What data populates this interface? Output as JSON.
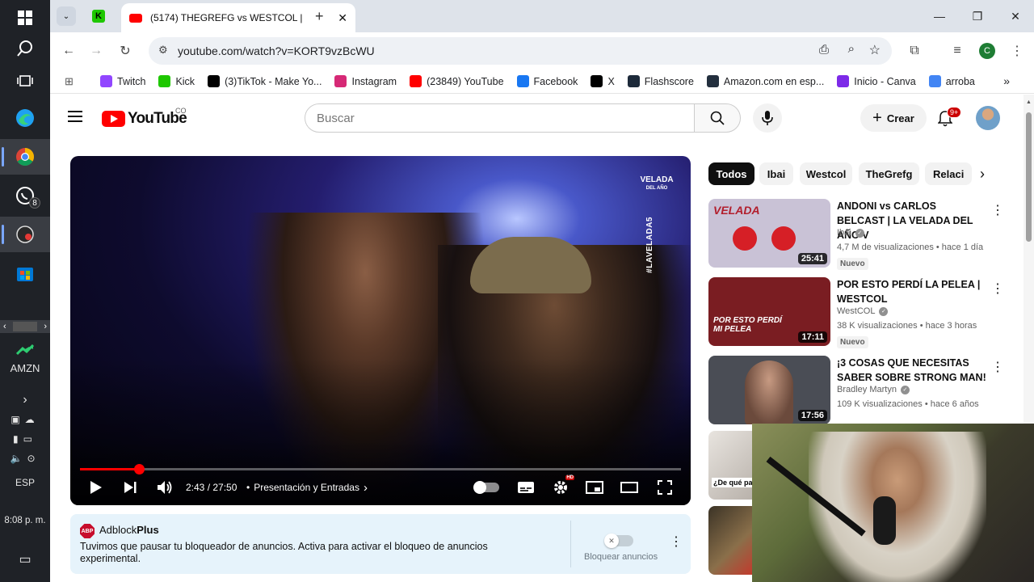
{
  "taskbar": {
    "whatsapp_badge": "8",
    "stock_label": "AMZN",
    "language": "ESP",
    "clock": "8:08 p. m."
  },
  "browser": {
    "tab_title": "(5174) THEGREFG vs WESTCOL |",
    "url": "youtube.com/watch?v=KORT9vzBcWU",
    "profile_letter": "C",
    "bookmarks": [
      {
        "label": "Twitch",
        "icon": "twitch-icon",
        "color": "#9146ff"
      },
      {
        "label": "Kick",
        "icon": "kick-icon",
        "color": "#1ec700"
      },
      {
        "label": "(3)TikTok - Make Yo...",
        "icon": "tiktok-icon",
        "color": "#000000"
      },
      {
        "label": "Instagram",
        "icon": "instagram-icon",
        "color": "#d62976"
      },
      {
        "label": "(23849) YouTube",
        "icon": "youtube-icon",
        "color": "#ff0000"
      },
      {
        "label": "Facebook",
        "icon": "facebook-icon",
        "color": "#1877f2"
      },
      {
        "label": "X",
        "icon": "x-icon",
        "color": "#000000"
      },
      {
        "label": "Flashscore",
        "icon": "flashscore-icon",
        "color": "#1d2a3a"
      },
      {
        "label": "Amazon.com en esp...",
        "icon": "amazon-icon",
        "color": "#232f3e"
      },
      {
        "label": "Inicio - Canva",
        "icon": "canva-icon",
        "color": "#7d2ae8"
      },
      {
        "label": "arroba",
        "icon": "google-icon",
        "color": "#4285f4"
      }
    ]
  },
  "youtube": {
    "logo_text": "YouTube",
    "country_code": "CO",
    "search_placeholder": "Buscar",
    "create_label": "Crear",
    "notif_count": "9+"
  },
  "player": {
    "watermark_top": "VELADA",
    "watermark_sub": "DEL AÑO",
    "hashtag": "#LAVELADA5",
    "time": "2:43 / 27:50",
    "chapter": "Presentación y Entradas",
    "hd_badge": "HD",
    "progress": 0.098
  },
  "adblock": {
    "brand_plain": "Adblock",
    "brand_bold": "Plus",
    "logo_text": "ABP",
    "message": "Tuvimos que pausar tu bloqueador de anuncios. Activa para activar el bloqueo de anuncios experimental.",
    "toggle_label": "Bloquear anuncios"
  },
  "chips": [
    "Todos",
    "Ibai",
    "Westcol",
    "TheGrefg",
    "Relaci"
  ],
  "recommendations": [
    {
      "title": "ANDONI vs CARLOS BELCAST | LA VELADA DEL AÑO V",
      "channel": "Ibai",
      "meta": "4,7 M de visualizaciones • hace 1 día",
      "badge": "Nuevo",
      "duration": "25:41",
      "thumb_color": "#c9c2d6",
      "thumb_text": "VELADA"
    },
    {
      "title": "POR ESTO PERDÍ LA PELEA | WESTCOL",
      "channel": "WestCOL",
      "meta": "38 K visualizaciones • hace 3 horas",
      "badge": "Nuevo",
      "duration": "17:11",
      "thumb_color": "#7a1d22",
      "thumb_text": "POR ESTO PERDÍ MI PELEA"
    },
    {
      "title": "¡3 COSAS QUE NECESITAS SABER SOBRE STRONG MAN!",
      "channel": "Bradley Martyn",
      "meta": "109 K visualizaciones • hace 6 años",
      "badge": "",
      "duration": "17:56",
      "thumb_color": "#4a4d55",
      "thumb_text": ""
    }
  ],
  "partial_thumb_text": "¿De qué pa"
}
